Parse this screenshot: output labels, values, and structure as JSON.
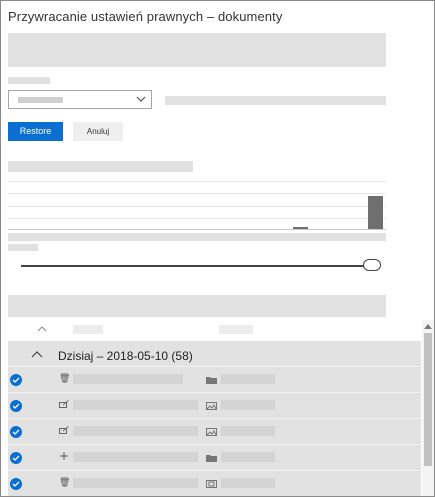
{
  "panel": {
    "title": "Przywracanie ustawień prawnych – dokumenty"
  },
  "actions": {
    "restore_label": "Restore",
    "cancel_label": "Anuluj"
  },
  "list": {
    "group_label": "Dzisiaj – 2018-05-10 (58)",
    "rows": [
      {
        "icon": "trash-icon",
        "type_icon": "folder-icon",
        "selected": true
      },
      {
        "icon": "edit-icon",
        "type_icon": "image-icon",
        "selected": true
      },
      {
        "icon": "edit-icon",
        "type_icon": "image-icon",
        "selected": true
      },
      {
        "icon": "plus-icon",
        "type_icon": "folder-icon",
        "selected": true
      },
      {
        "icon": "trash-icon",
        "type_icon": "document-icon",
        "selected": true
      }
    ]
  },
  "colors": {
    "accent": "#0a6fd1",
    "placeholder": "#e1e1e1",
    "list_background": "#e2e2e2"
  }
}
